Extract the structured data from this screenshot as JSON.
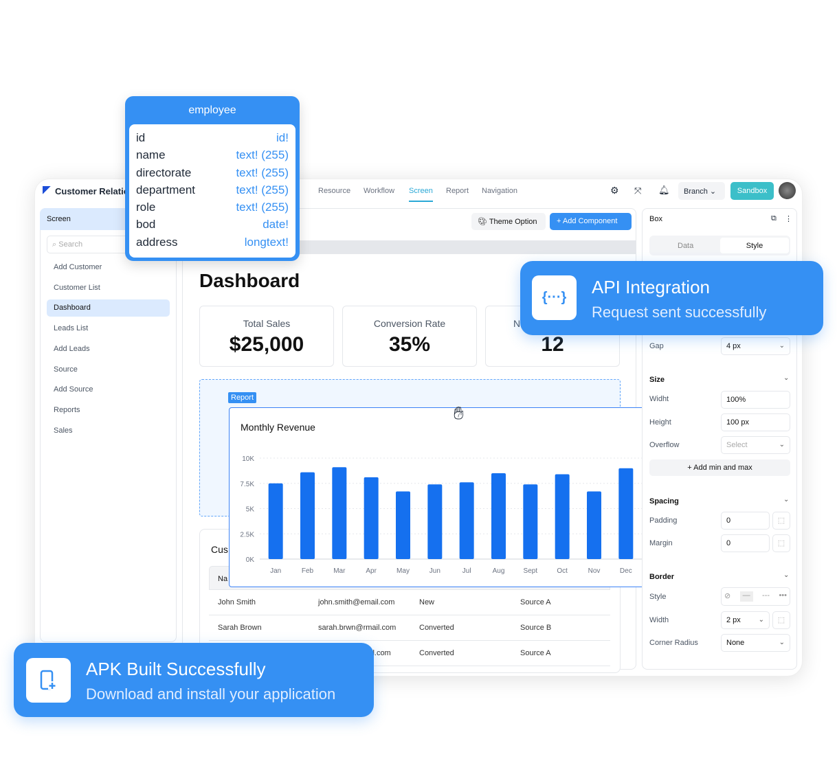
{
  "app": {
    "title": "Customer Relatio"
  },
  "nav": {
    "tabs": [
      "Resource",
      "Workflow",
      "Screen",
      "Report",
      "Navigation"
    ],
    "active": "Screen",
    "branch": "Branch",
    "sandbox": "Sandbox"
  },
  "sidebar": {
    "header": "Screen",
    "search_placeholder": "Search",
    "items": [
      "Add Customer",
      "Customer List",
      "Dashboard",
      "Leads List",
      "Add Leads",
      "Source",
      "Add Source",
      "Reports",
      "Sales"
    ],
    "selected": "Dashboard"
  },
  "toolbar": {
    "theme": "Theme Option",
    "add": "+ Add Component"
  },
  "dashboard": {
    "title": "Dashboard",
    "kpis": [
      {
        "label": "Total Sales",
        "value": "$25,000"
      },
      {
        "label": "Conversion Rate",
        "value": "35%"
      },
      {
        "label": "N",
        "value": "12"
      }
    ],
    "report_tag": "Report"
  },
  "customers": {
    "title": "Cus",
    "header_first": "Na",
    "rows": [
      [
        "John Smith",
        "john.smith@email.com",
        "New",
        "Source A"
      ],
      [
        "Sarah Brown",
        "sarah.brwn@rmail.com",
        "Converted",
        "Source B"
      ],
      [
        "",
        "il.com",
        "Converted",
        "Source A"
      ]
    ]
  },
  "chart_data": {
    "type": "bar",
    "title": "Monthly Revenue",
    "categories": [
      "Jan",
      "Feb",
      "Mar",
      "Apr",
      "May",
      "Jun",
      "Jul",
      "Aug",
      "Sept",
      "Oct",
      "Nov",
      "Dec"
    ],
    "values": [
      7500,
      8600,
      9100,
      8100,
      6700,
      7400,
      7600,
      8500,
      7400,
      8400,
      6700,
      9000
    ],
    "yticks": [
      "0K",
      "2.5K",
      "5K",
      "7.5K",
      "10K"
    ],
    "ylim": [
      0,
      10000
    ],
    "grid": true,
    "color": "#1570ef"
  },
  "props": {
    "title": "Box",
    "tabs": [
      "Data",
      "Style"
    ],
    "active_tab": "Style",
    "gap_label": "Gap",
    "gap": "4 px",
    "size": "Size",
    "width_label": "Widht",
    "width": "100%",
    "height_label": "Height",
    "height": "100 px",
    "overflow_label": "Overflow",
    "overflow_placeholder": "Select",
    "add_minmax": "+ Add min and max",
    "spacing": "Spacing",
    "padding_label": "Padding",
    "padding": "0",
    "margin_label": "Margin",
    "margin": "0",
    "border": "Border",
    "style_label": "Style",
    "bwidth_label": "Width",
    "bwidth": "2 px",
    "radius_label": "Corner Radius",
    "radius": "None"
  },
  "employee": {
    "title": "employee",
    "fields": [
      [
        "id",
        "id!"
      ],
      [
        "name",
        "text! (255)"
      ],
      [
        "directorate",
        "text! (255)"
      ],
      [
        "department",
        "text! (255)"
      ],
      [
        "role",
        "text! (255)"
      ],
      [
        "bod",
        "date!"
      ],
      [
        "address",
        "longtext!"
      ]
    ]
  },
  "toasts": {
    "api_title": "API Integration",
    "api_sub": "Request sent successfully",
    "apk_title": "APK Built Successfully",
    "apk_sub": "Download and install your application"
  },
  "colors": {
    "accent": "#3590f3",
    "teal": "#3cbfc9",
    "selected": "#dbeafe"
  }
}
